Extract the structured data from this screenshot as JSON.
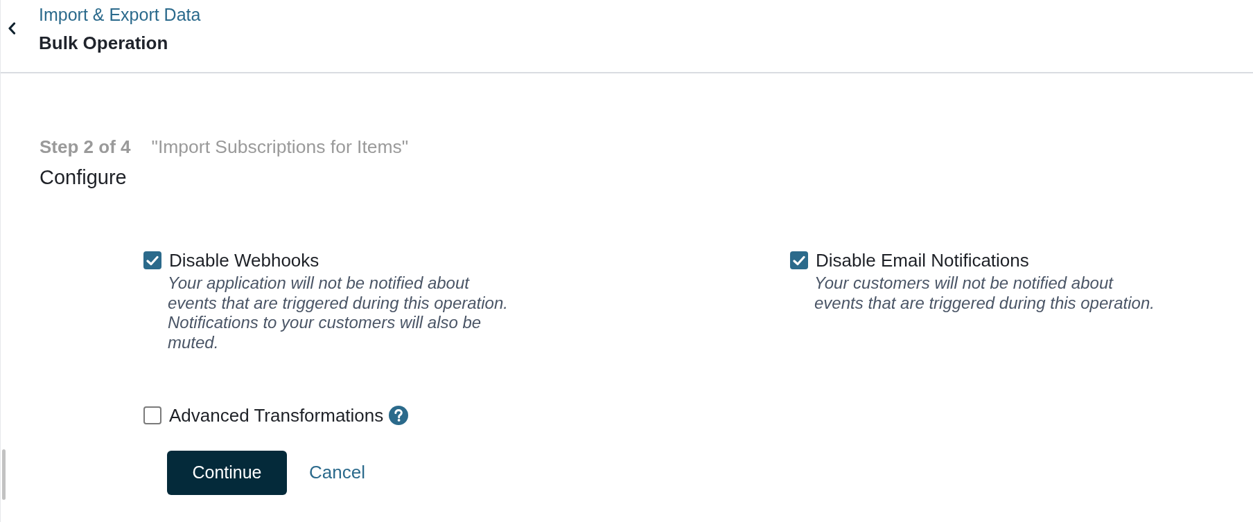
{
  "header": {
    "breadcrumb": "Import & Export Data",
    "title": "Bulk Operation"
  },
  "step": {
    "counter": "Step 2 of 4",
    "operation": "\"Import Subscriptions for Items\"",
    "title": "Configure"
  },
  "options": [
    {
      "label": "Disable Webhooks",
      "checked": true,
      "help": false,
      "description_lines": [
        "Your application will not be notified about",
        "events that are triggered during this operation.",
        "Notifications to your customers will also be",
        "muted."
      ]
    },
    {
      "label": "Disable Email Notifications",
      "checked": true,
      "help": false,
      "description_lines": [
        "Your customers will not be notified about",
        "events that are triggered during this operation."
      ]
    },
    {
      "label": "Advanced Transformations",
      "checked": false,
      "help": true
    }
  ],
  "actions": {
    "primary": "Continue",
    "secondary": "Cancel"
  }
}
